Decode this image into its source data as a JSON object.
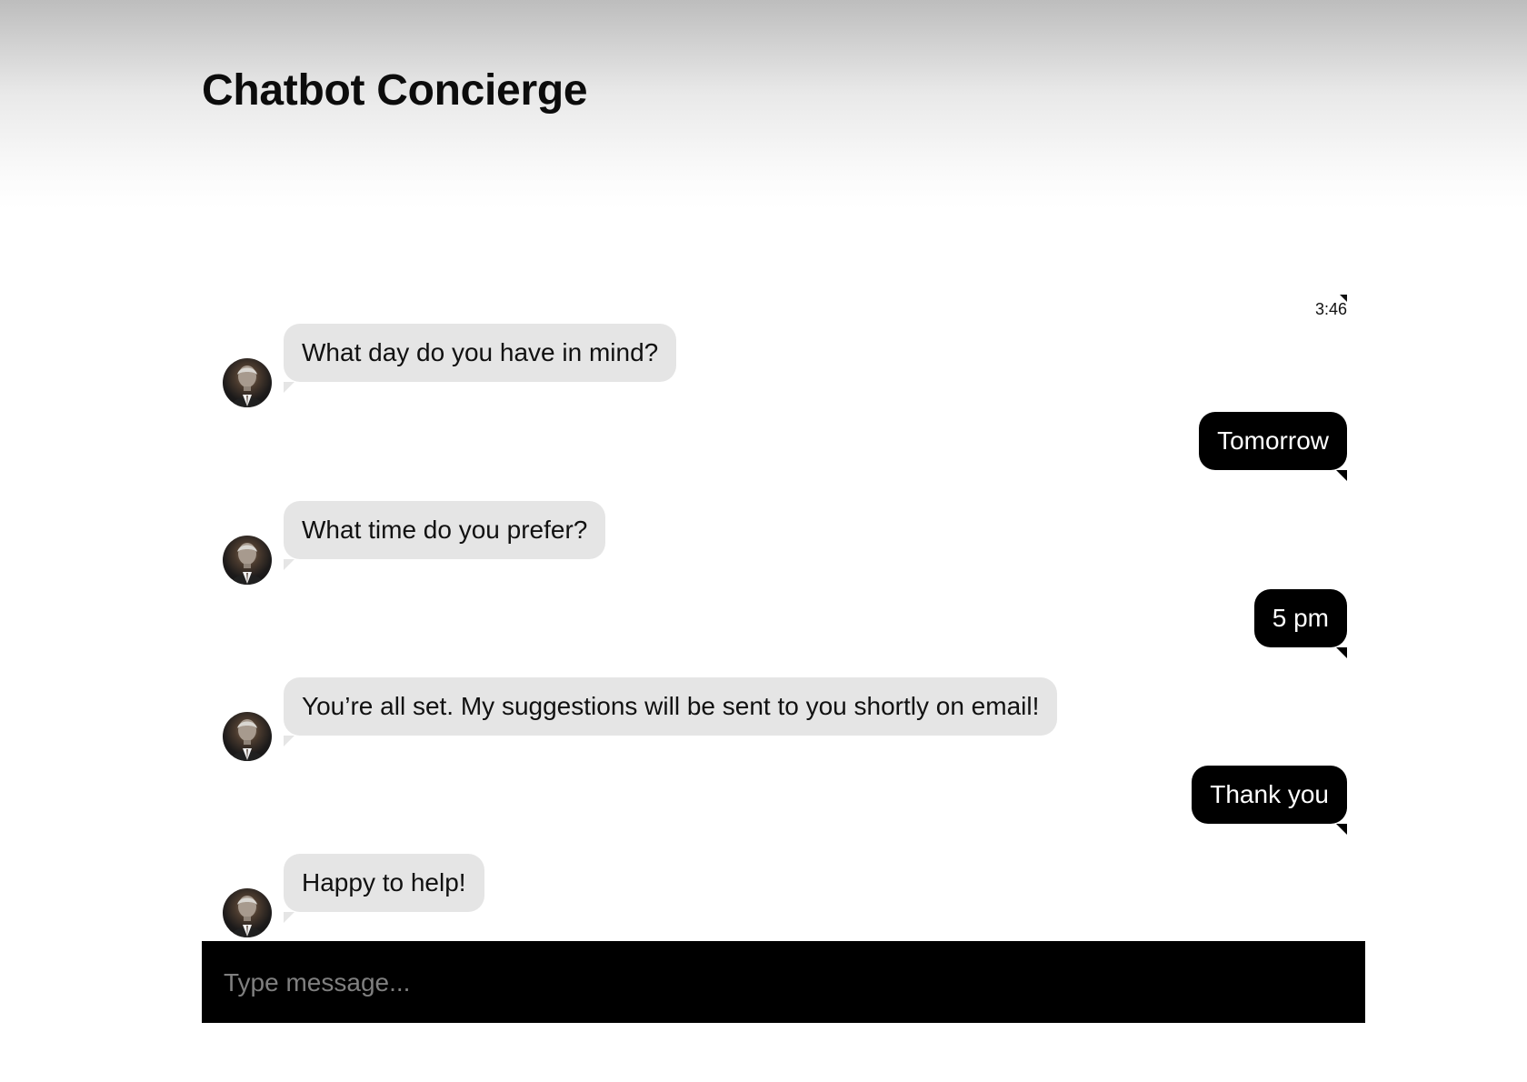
{
  "app": {
    "title": "Chatbot Concierge"
  },
  "conversation": {
    "timestamp": "3:46",
    "messages": [
      {
        "sender": "bot",
        "text": "What day do you have in mind?"
      },
      {
        "sender": "user",
        "text": "Tomorrow"
      },
      {
        "sender": "bot",
        "text": "What time do you prefer?"
      },
      {
        "sender": "user",
        "text": "5 pm"
      },
      {
        "sender": "bot",
        "text": "You’re all set. My suggestions will be sent to you shortly on email!"
      },
      {
        "sender": "user",
        "text": "Thank you"
      },
      {
        "sender": "bot",
        "text": "Happy to help!"
      }
    ]
  },
  "composer": {
    "placeholder": "Type message...",
    "value": ""
  },
  "colors": {
    "bot_bubble": "#e5e5e5",
    "user_bubble": "#000000",
    "composer_background": "#000000"
  },
  "icons": {
    "bot_avatar": "bot-avatar-icon",
    "timestamp_marker": "timestamp-marker-icon"
  }
}
